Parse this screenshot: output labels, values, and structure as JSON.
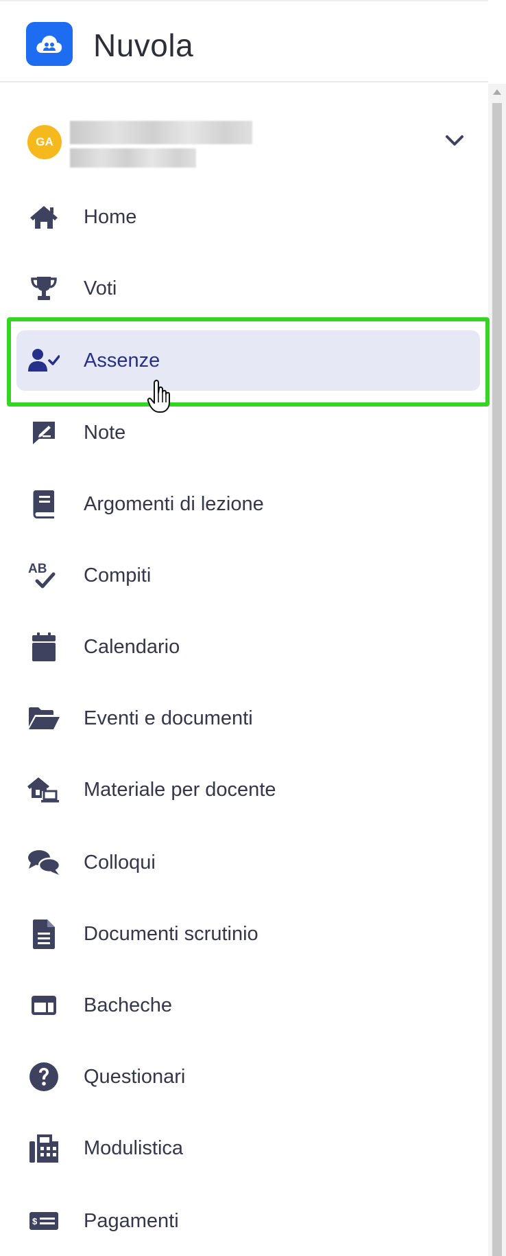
{
  "app": {
    "title": "Nuvola"
  },
  "user": {
    "initials": "GA"
  },
  "nav": {
    "items": [
      {
        "label": "Home",
        "icon": "home-icon"
      },
      {
        "label": "Voti",
        "icon": "trophy-icon"
      },
      {
        "label": "Assenze",
        "icon": "user-check-icon",
        "active": true
      },
      {
        "label": "Note",
        "icon": "note-icon"
      },
      {
        "label": "Argomenti di lezione",
        "icon": "book-icon"
      },
      {
        "label": "Compiti",
        "icon": "spellcheck-icon"
      },
      {
        "label": "Calendario",
        "icon": "calendar-icon"
      },
      {
        "label": "Eventi e documenti",
        "icon": "folder-open-icon"
      },
      {
        "label": "Materiale per docente",
        "icon": "house-laptop-icon"
      },
      {
        "label": "Colloqui",
        "icon": "comments-icon"
      },
      {
        "label": "Documenti scrutinio",
        "icon": "file-lines-icon"
      },
      {
        "label": "Bacheche",
        "icon": "board-icon"
      },
      {
        "label": "Questionari",
        "icon": "question-circle-icon"
      },
      {
        "label": "Modulistica",
        "icon": "fax-icon"
      },
      {
        "label": "Pagamenti",
        "icon": "money-check-icon"
      }
    ]
  },
  "colors": {
    "brand": "#1e6cf2",
    "avatar": "#f5b91e",
    "icon": "#3f425e",
    "active_bg": "#e6e8f6",
    "active_text": "#26308a",
    "highlight": "#35d621"
  }
}
